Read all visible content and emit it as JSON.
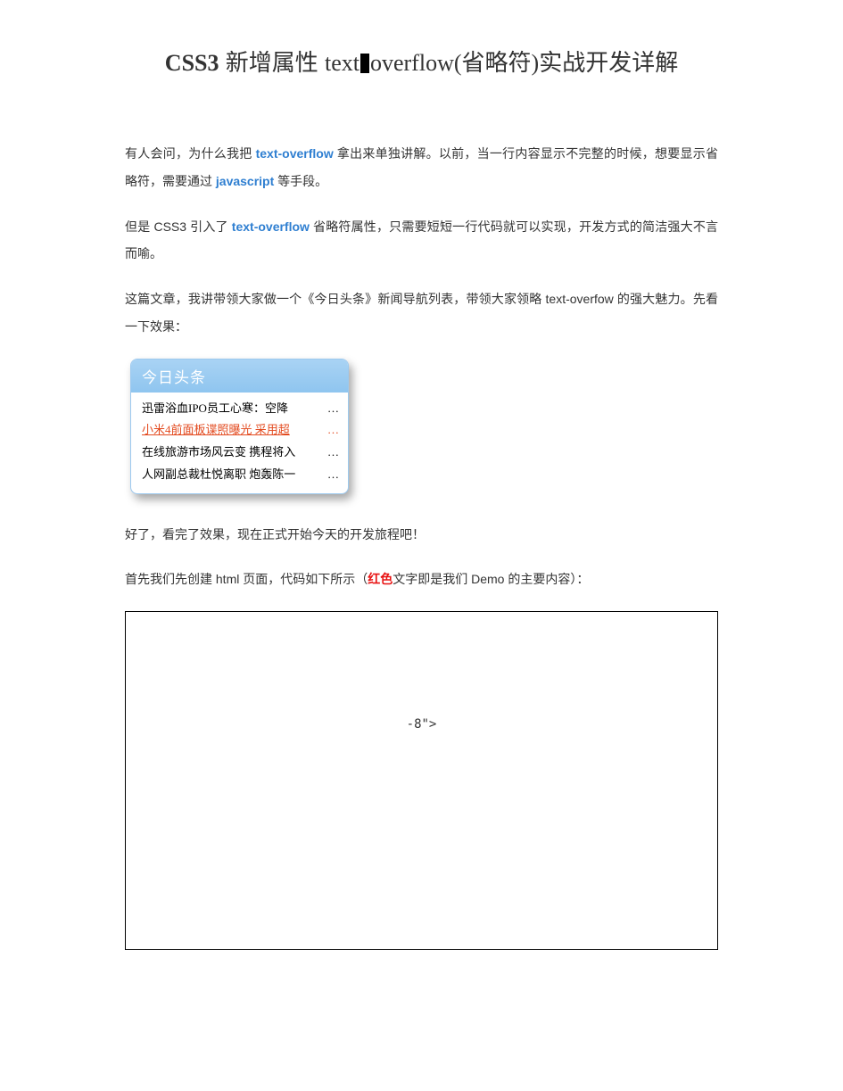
{
  "title": {
    "part1_latin_bold": "CSS3",
    "part2_cjk": "新增属性",
    "part3_latin": "text",
    "part4_latin": "overflow(",
    "part5_cjk": "省略符",
    "part6_latin": ")",
    "part7_cjk": "实战开发详解"
  },
  "para1": {
    "t1": "有人会问，为什么我把 ",
    "kw1": "text-overflow",
    "t2": " 拿出来单独讲解。以前，当一行内容显示不完整的时候，想要显示省略符，需要通过 ",
    "kw2": "javascript",
    "t3": " 等手段。"
  },
  "para2": {
    "t1": "但是 CSS3 引入了 ",
    "kw1": "text-overflow",
    "t2": " 省略符属性，只需要短短一行代码就可以实现，开发方式的简洁强大不言而喻。"
  },
  "para3": "这篇文章，我讲带领大家做一个《今日头条》新闻导航列表，带领大家领略 text-overfow 的强大魅力。先看一下效果：",
  "demo": {
    "header": "今日头条",
    "items": [
      "迅雷浴血IPO员工心寒：空降",
      "小米4前面板谍照曝光  采用超",
      "在线旅游市场风云变  携程将入",
      "人网副总裁杜悦离职  炮轰陈一"
    ],
    "hover_index": 1
  },
  "para4": "好了，看完了效果，现在正式开始今天的开发旅程吧！",
  "para5": {
    "t1": "首先我们先创建 html 页面，代码如下所示（",
    "red": "红色",
    "t2": "文字即是我们 Demo 的主要内容）："
  },
  "code": {
    "line1": "-8\">"
  }
}
